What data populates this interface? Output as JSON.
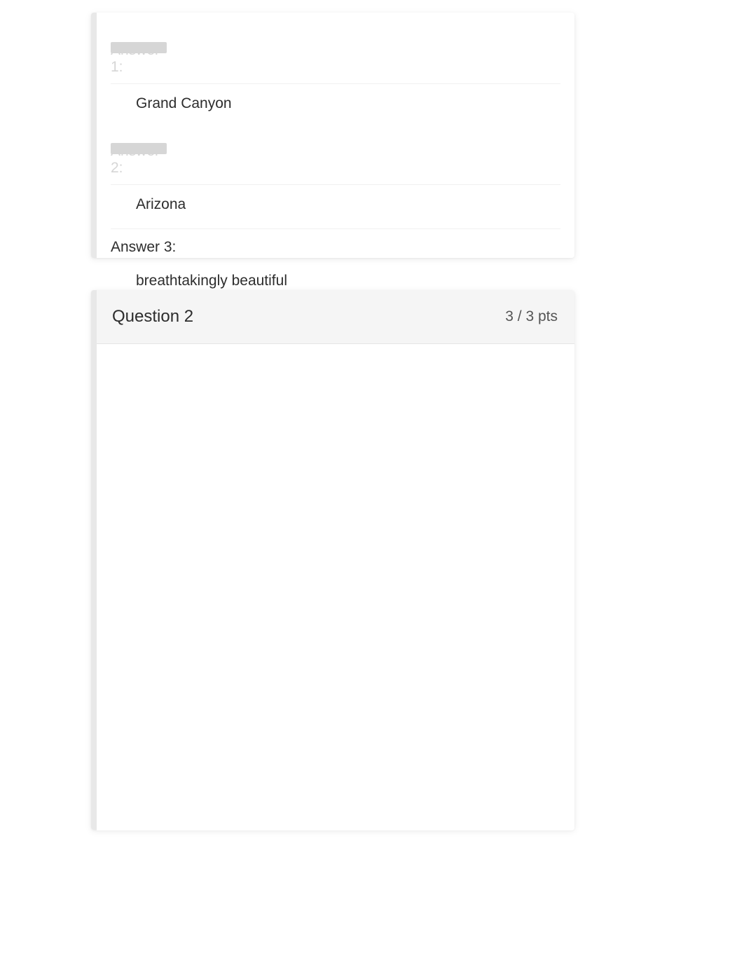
{
  "question1": {
    "answers": [
      {
        "label": "Answer 1:",
        "value": "Grand Canyon",
        "redacted": true
      },
      {
        "label": "Answer 2:",
        "value": "Arizona",
        "redacted": true
      },
      {
        "label": "Answer 3:",
        "value": "breathtakingly beautiful",
        "redacted": false
      }
    ]
  },
  "question2": {
    "title": "Question 2",
    "points": "3 / 3 pts"
  }
}
